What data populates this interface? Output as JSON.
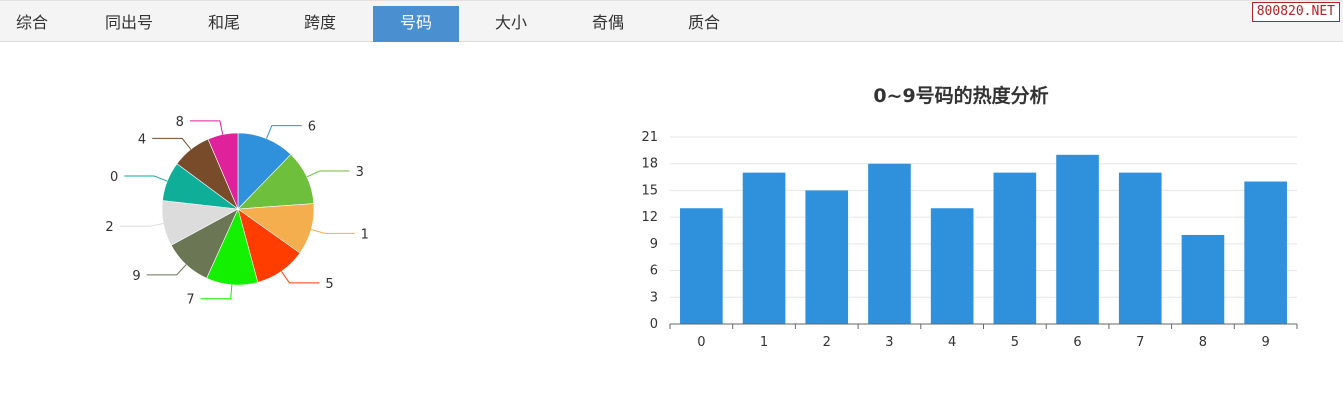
{
  "tabs": [
    {
      "label": "综合"
    },
    {
      "label": "同出号"
    },
    {
      "label": "和尾"
    },
    {
      "label": "跨度"
    },
    {
      "label": "号码",
      "active": true
    },
    {
      "label": "大小"
    },
    {
      "label": "奇偶"
    },
    {
      "label": "质合"
    }
  ],
  "watermark": "800820.NET",
  "chart_data": [
    {
      "type": "pie",
      "title": "",
      "legend": "none",
      "slices": [
        {
          "label": "6",
          "value": 19,
          "color": "#2f91dc"
        },
        {
          "label": "3",
          "value": 18,
          "color": "#6dbf3c"
        },
        {
          "label": "1",
          "value": 17,
          "color": "#f5ae4e"
        },
        {
          "label": "5",
          "value": 17,
          "color": "#ff3d00"
        },
        {
          "label": "7",
          "value": 17,
          "color": "#13f000"
        },
        {
          "label": "9",
          "value": 16,
          "color": "#6b7654"
        },
        {
          "label": "2",
          "value": 15,
          "color": "#dcdcdc"
        },
        {
          "label": "0",
          "value": 13,
          "color": "#0fae98"
        },
        {
          "label": "4",
          "value": 13,
          "color": "#784b2b"
        },
        {
          "label": "8",
          "value": 10,
          "color": "#e0219c"
        }
      ]
    },
    {
      "type": "bar",
      "title": "0~9号码的热度分析",
      "categories": [
        "0",
        "1",
        "2",
        "3",
        "4",
        "5",
        "6",
        "7",
        "8",
        "9"
      ],
      "values": [
        13,
        17,
        15,
        18,
        13,
        17,
        19,
        17,
        10,
        16
      ],
      "ylim": [
        0,
        21
      ],
      "yticks": [
        "0",
        "3",
        "6",
        "9",
        "12",
        "15",
        "18",
        "21"
      ],
      "grid": true,
      "bar_color": "#2f91dc"
    }
  ]
}
